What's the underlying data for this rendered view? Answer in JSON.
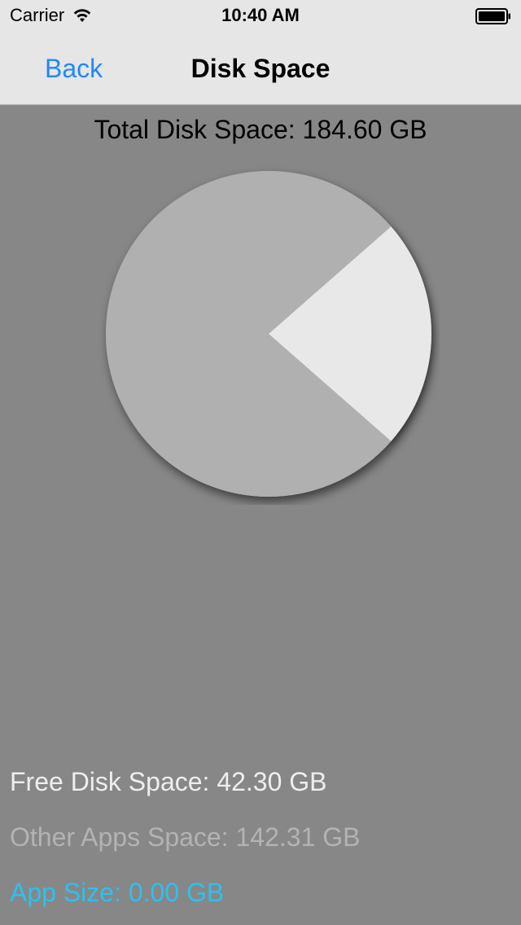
{
  "status_bar": {
    "carrier": "Carrier",
    "time": "10:40 AM",
    "icons": [
      "wifi-icon",
      "battery-icon"
    ]
  },
  "nav": {
    "back_label": "Back",
    "title": "Disk Space"
  },
  "total_label": "Total Disk Space: 184.60 GB",
  "legend": {
    "free": "Free Disk Space: 42.30 GB",
    "other": "Other Apps Space: 142.31 GB",
    "app": "App Size: 0.00 GB"
  },
  "chart_data": {
    "type": "pie",
    "unit": "GB",
    "slices": [
      {
        "label": "Free Disk Space",
        "value": 42.3,
        "color": "#e8e8e8"
      },
      {
        "label": "Other Apps Space",
        "value": 142.31,
        "color": "#b0b0b0"
      },
      {
        "label": "App Size",
        "value": 0.0,
        "color": "#2ec0ee"
      }
    ]
  },
  "colors": {
    "background": "#878787",
    "bar": "#e6e6e6",
    "link": "#1e88ff",
    "free_text": "#eeeeee",
    "other_text": "#b3b3b3",
    "app_text": "#2ec0ee"
  }
}
